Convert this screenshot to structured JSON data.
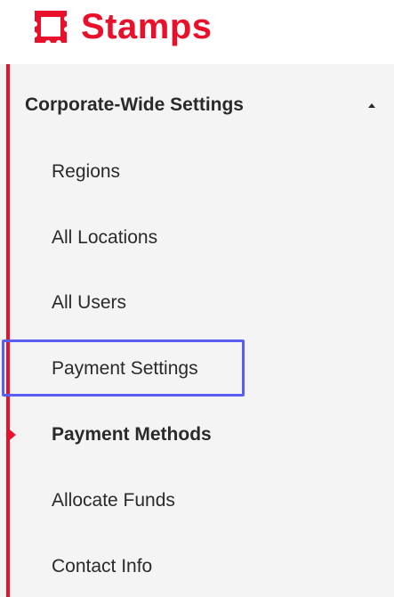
{
  "brand": {
    "name": "Stamps",
    "color": "#e8102a",
    "icon": "stamp-icon"
  },
  "sidebar": {
    "section_title": "Corporate-Wide Settings",
    "section_state_icon": "caret-up-icon",
    "items": [
      {
        "label": "Regions",
        "active": false
      },
      {
        "label": "All Locations",
        "active": false
      },
      {
        "label": "All Users",
        "active": false
      },
      {
        "label": "Payment Settings",
        "active": false,
        "highlighted": true
      },
      {
        "label": "Payment Methods",
        "active": true
      },
      {
        "label": "Allocate Funds",
        "active": false
      },
      {
        "label": "Contact Info",
        "active": false
      }
    ]
  },
  "colors": {
    "accent": "#e8102a",
    "highlight": "#5b5ef0",
    "sidebar_bg": "#f4f4f4",
    "text": "#2a2a2a"
  }
}
